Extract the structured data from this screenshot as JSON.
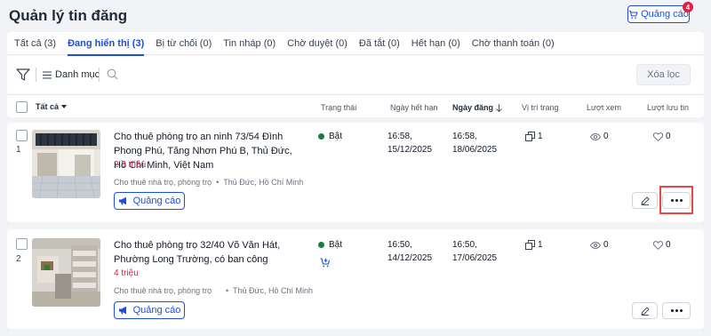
{
  "page": {
    "title": "Quản lý tin đăng"
  },
  "header": {
    "ad_button_label": "Quảng cáo",
    "ad_badge_count": "4"
  },
  "tabs": [
    {
      "label": "Tất cả (3)",
      "active": false
    },
    {
      "label": "Đang hiển thị (3)",
      "active": true
    },
    {
      "label": "Bị từ chối (0)",
      "active": false
    },
    {
      "label": "Tin nháp (0)",
      "active": false
    },
    {
      "label": "Chờ duyệt (0)",
      "active": false
    },
    {
      "label": "Đã tắt (0)",
      "active": false
    },
    {
      "label": "Hết hạn (0)",
      "active": false
    },
    {
      "label": "Chờ thanh toán (0)",
      "active": false
    }
  ],
  "toolbar": {
    "category_label": "Danh mục",
    "clear_filter_label": "Xóa lọc"
  },
  "columns": {
    "all": "Tất cả",
    "status": "Trạng thái",
    "expiry": "Ngày hết hạn",
    "posted": "Ngày đăng",
    "position": "Vị trí trang",
    "views": "Lượt xem",
    "saves": "Lượt lưu tin"
  },
  "listings": [
    {
      "index": "1",
      "title": "Cho thuê phòng trọ an ninh 73/54 Đình Phong Phú, Tăng Nhơn Phú B, Thủ Đức, Hồ Chí Minh, Việt Nam",
      "price": "2.9 triệu",
      "category": "Cho thuê nhà trọ, phòng trọ",
      "location": "Thủ Đức, Hồ Chí Minh",
      "ad_label": "Quảng cáo",
      "status": "Bật",
      "expiry_time": "16:58,",
      "expiry_date": "15/12/2025",
      "posted_time": "16:58,",
      "posted_date": "18/06/2025",
      "position": "1",
      "views": "0",
      "saves": "0"
    },
    {
      "index": "2",
      "title": "Cho thuê phòng trọ 32/40 Võ Văn Hát, Phường Long Trường, có ban công",
      "price": "4 triệu",
      "category": "Cho thuê nhà trọ, phòng trọ",
      "location": "Thủ Đức, Hồ Chí Minh",
      "ad_label": "Quảng cáo",
      "status": "Bật",
      "expiry_time": "16:50,",
      "expiry_date": "14/12/2025",
      "posted_time": "16:50,",
      "posted_date": "17/06/2025",
      "position": "1",
      "views": "0",
      "saves": "0"
    }
  ],
  "colors": {
    "accent": "#1d4ed8",
    "price": "#e11d48",
    "status_on": "#15803d",
    "highlight": "#ef4444"
  },
  "icons": [
    "cart-icon",
    "filter-icon",
    "menu-icon",
    "search-icon",
    "megaphone-icon",
    "copy-icon",
    "eye-icon",
    "heart-icon",
    "pencil-icon",
    "more-icon",
    "cart-plus-icon",
    "sort-down-icon",
    "caret-down-icon"
  ]
}
